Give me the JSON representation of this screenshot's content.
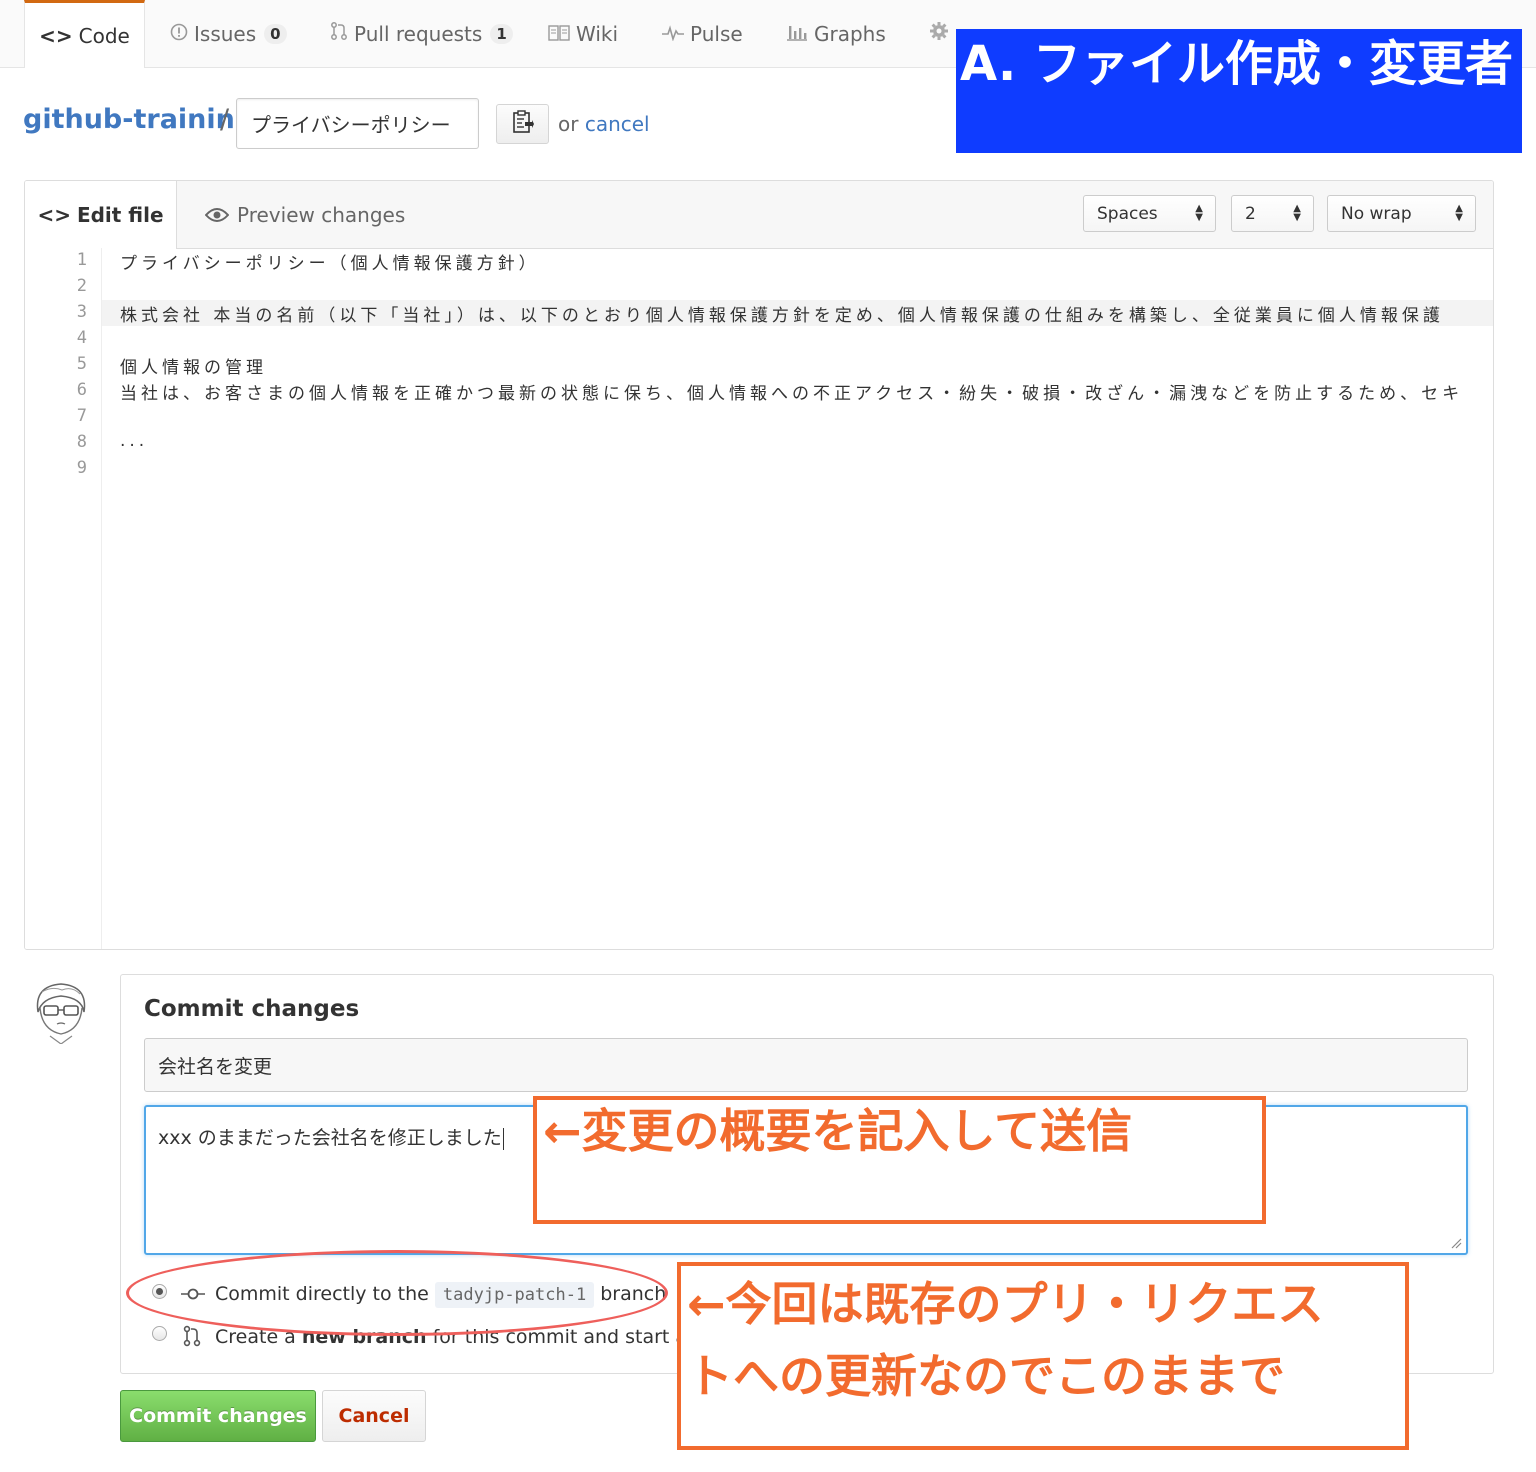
{
  "nav": {
    "tabs": [
      {
        "label": "Code",
        "icon": "code-icon"
      },
      {
        "label": "Issues",
        "icon": "issue-icon",
        "count": "0"
      },
      {
        "label": "Pull requests",
        "icon": "pull-request-icon",
        "count": "1"
      },
      {
        "label": "Wiki",
        "icon": "book-icon"
      },
      {
        "label": "Pulse",
        "icon": "pulse-icon"
      },
      {
        "label": "Graphs",
        "icon": "graph-icon"
      },
      {
        "label": "",
        "icon": "gear-icon"
      }
    ]
  },
  "banner": {
    "text": "A. ファイル作成・変更者",
    "color": "#0f3cff"
  },
  "breadcrumb": {
    "repo": "github-training",
    "separator": "/",
    "filename": "プライバシーポリシー",
    "or_text": "or ",
    "cancel_label": "cancel"
  },
  "editor": {
    "tab_edit": "Edit file",
    "tab_preview": "Preview changes",
    "indent_mode": "Spaces",
    "indent_size": "2",
    "wrap_mode": "No wrap",
    "lines": [
      {
        "num": "1",
        "text": "プライバシーポリシー（個人情報保護方針）"
      },
      {
        "num": "2",
        "text": ""
      },
      {
        "num": "3",
        "text": "株式会社 本当の名前（以下「当社」）は、以下のとおり個人情報保護方針を定め、個人情報保護の仕組みを構築し、全従業員に個人情報保護"
      },
      {
        "num": "4",
        "text": ""
      },
      {
        "num": "5",
        "text": "個人情報の管理"
      },
      {
        "num": "6",
        "text": "当社は、お客さまの個人情報を正確かつ最新の状態に保ち、個人情報への不正アクセス・紛失・破損・改ざん・漏洩などを防止するため、セキ"
      },
      {
        "num": "7",
        "text": ""
      },
      {
        "num": "8",
        "text": "..."
      },
      {
        "num": "9",
        "text": ""
      }
    ]
  },
  "commit": {
    "title": "Commit changes",
    "summary_value": "会社名を変更",
    "description_value": "xxx のままだった会社名を修正しました",
    "option_direct_prefix": "Commit directly to the",
    "branch_name": "tadyjp-patch-1",
    "option_direct_suffix": "branch",
    "option_new_prefix": "Create a",
    "option_new_bold": "new branch",
    "option_new_suffix": "for this commit and start a pull",
    "submit_label": "Commit changes",
    "cancel_label": "Cancel"
  },
  "annotations": {
    "note_send": "←変更の概要を記入して送信",
    "note_keep_line1": "←今回は既存のプリ・リクエス",
    "note_keep_line2": "トへの更新なのでこのままで",
    "accent_color": "#f26b2e"
  }
}
